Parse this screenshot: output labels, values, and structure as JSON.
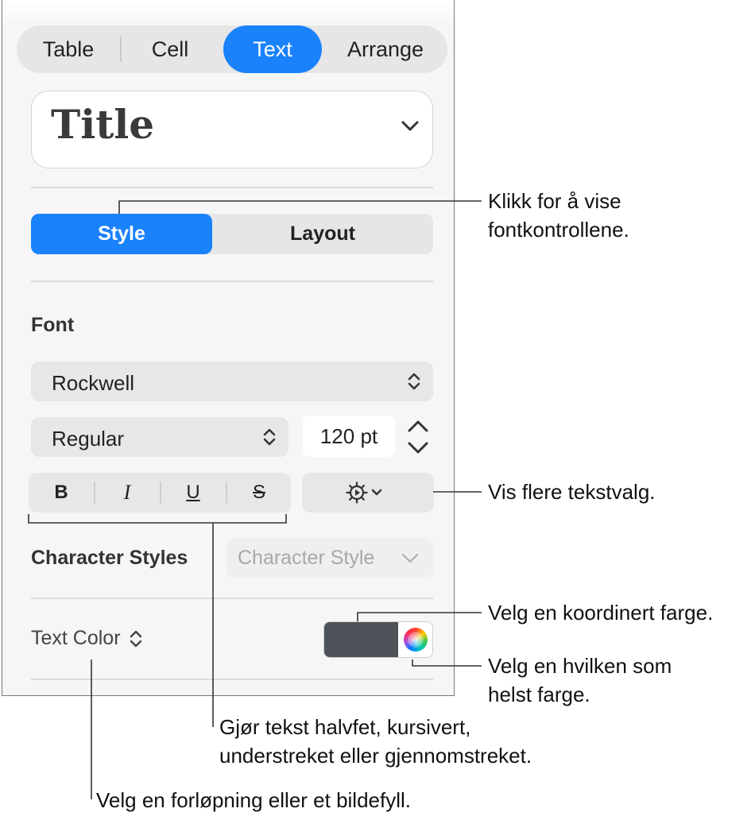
{
  "tabs": [
    {
      "label": "Table",
      "active": false
    },
    {
      "label": "Cell",
      "active": false
    },
    {
      "label": "Text",
      "active": true
    },
    {
      "label": "Arrange",
      "active": false
    }
  ],
  "paragraph_style": {
    "value": "Title",
    "icon": "chevron-down-icon"
  },
  "segmented": {
    "style_label": "Style",
    "layout_label": "Layout",
    "selected": "Style"
  },
  "font": {
    "section_label": "Font",
    "family": "Rockwell",
    "typeface": "Regular",
    "size": "120 pt"
  },
  "format_buttons": {
    "bold": "B",
    "italic": "I",
    "underline": "U",
    "strikethrough": "S"
  },
  "character_styles": {
    "label": "Character Styles",
    "placeholder": "Character Style"
  },
  "text_color": {
    "label": "Text Color",
    "swatch_color": "#4d5158"
  },
  "colors": {
    "accent": "#1a82fb"
  },
  "callouts": {
    "style_tab": [
      "Klikk for å vise",
      "fontkontrollene."
    ],
    "more_options": [
      "Vis flere tekstvalg."
    ],
    "coordinated_color": [
      "Velg en koordinert farge."
    ],
    "any_color": [
      "Velg en hvilken som",
      "helst farge."
    ],
    "format": [
      "Gjør tekst halvfet, kursivert,",
      "understreket eller gjennomstreket."
    ],
    "fill": [
      "Velg en forløpning eller et bildefyll."
    ]
  }
}
